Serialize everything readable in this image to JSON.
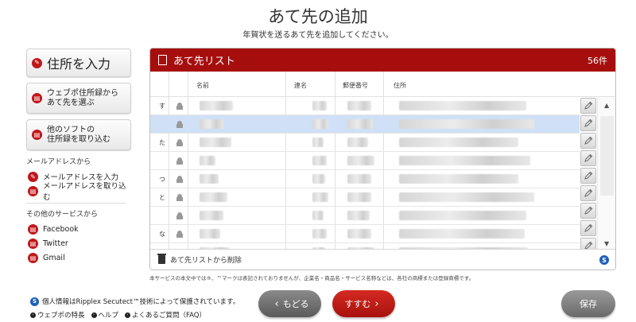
{
  "page": {
    "title": "あて先の追加",
    "subtitle": "年賀状を送るあて先を追加してください。"
  },
  "sidebar": {
    "primary": {
      "label": "住所を入力"
    },
    "secondary": [
      {
        "label": "ウェブポ住所録から\nあて先を選ぶ"
      },
      {
        "label": "他のソフトの\n住所録を取り込む"
      }
    ],
    "email_section": {
      "title": "メールアドレスから",
      "items": [
        {
          "label": "メールアドレスを入力"
        },
        {
          "label": "メールアドレスを取り込む"
        }
      ]
    },
    "services_section": {
      "title": "その他のサービスから",
      "items": [
        {
          "label": "Facebook"
        },
        {
          "label": "Twitter"
        },
        {
          "label": "Gmail"
        }
      ]
    }
  },
  "panel": {
    "title": "あて先リスト",
    "count": "56件",
    "columns": {
      "name": "名前",
      "rengo": "連名",
      "postal": "郵便番号",
      "address": "住所"
    },
    "rows": [
      {
        "kana": "す",
        "selected": false
      },
      {
        "kana": "",
        "selected": true
      },
      {
        "kana": "た",
        "selected": false
      },
      {
        "kana": "",
        "selected": false
      },
      {
        "kana": "つ",
        "selected": false
      },
      {
        "kana": "と",
        "selected": false
      },
      {
        "kana": "",
        "selected": false
      },
      {
        "kana": "な",
        "selected": false
      },
      {
        "kana": "",
        "selected": false
      }
    ],
    "footer_label": "あて先リストから削除",
    "scroll_up": "▲",
    "scroll_down": "▼"
  },
  "disclaimer": "本サービスの本文中では®、™マークは表記されておりませんが、企業名・商品名・サービス名称などは、各社の商標または登録商標です。",
  "bottom": {
    "security_text": "個人情報はRipplex Secutect™技術によって保護されています。",
    "help_links": [
      {
        "label": "ウェブポの特長"
      },
      {
        "label": "ヘルプ"
      },
      {
        "label": "よくあるご質問（FAQ）"
      }
    ],
    "back_label": "もどる",
    "next_label": "すすむ",
    "save_label": "保存"
  },
  "colors": {
    "accent_red": "#a60e0e",
    "selected_row": "#cfe0f7",
    "security_blue": "#1d5fb8"
  }
}
